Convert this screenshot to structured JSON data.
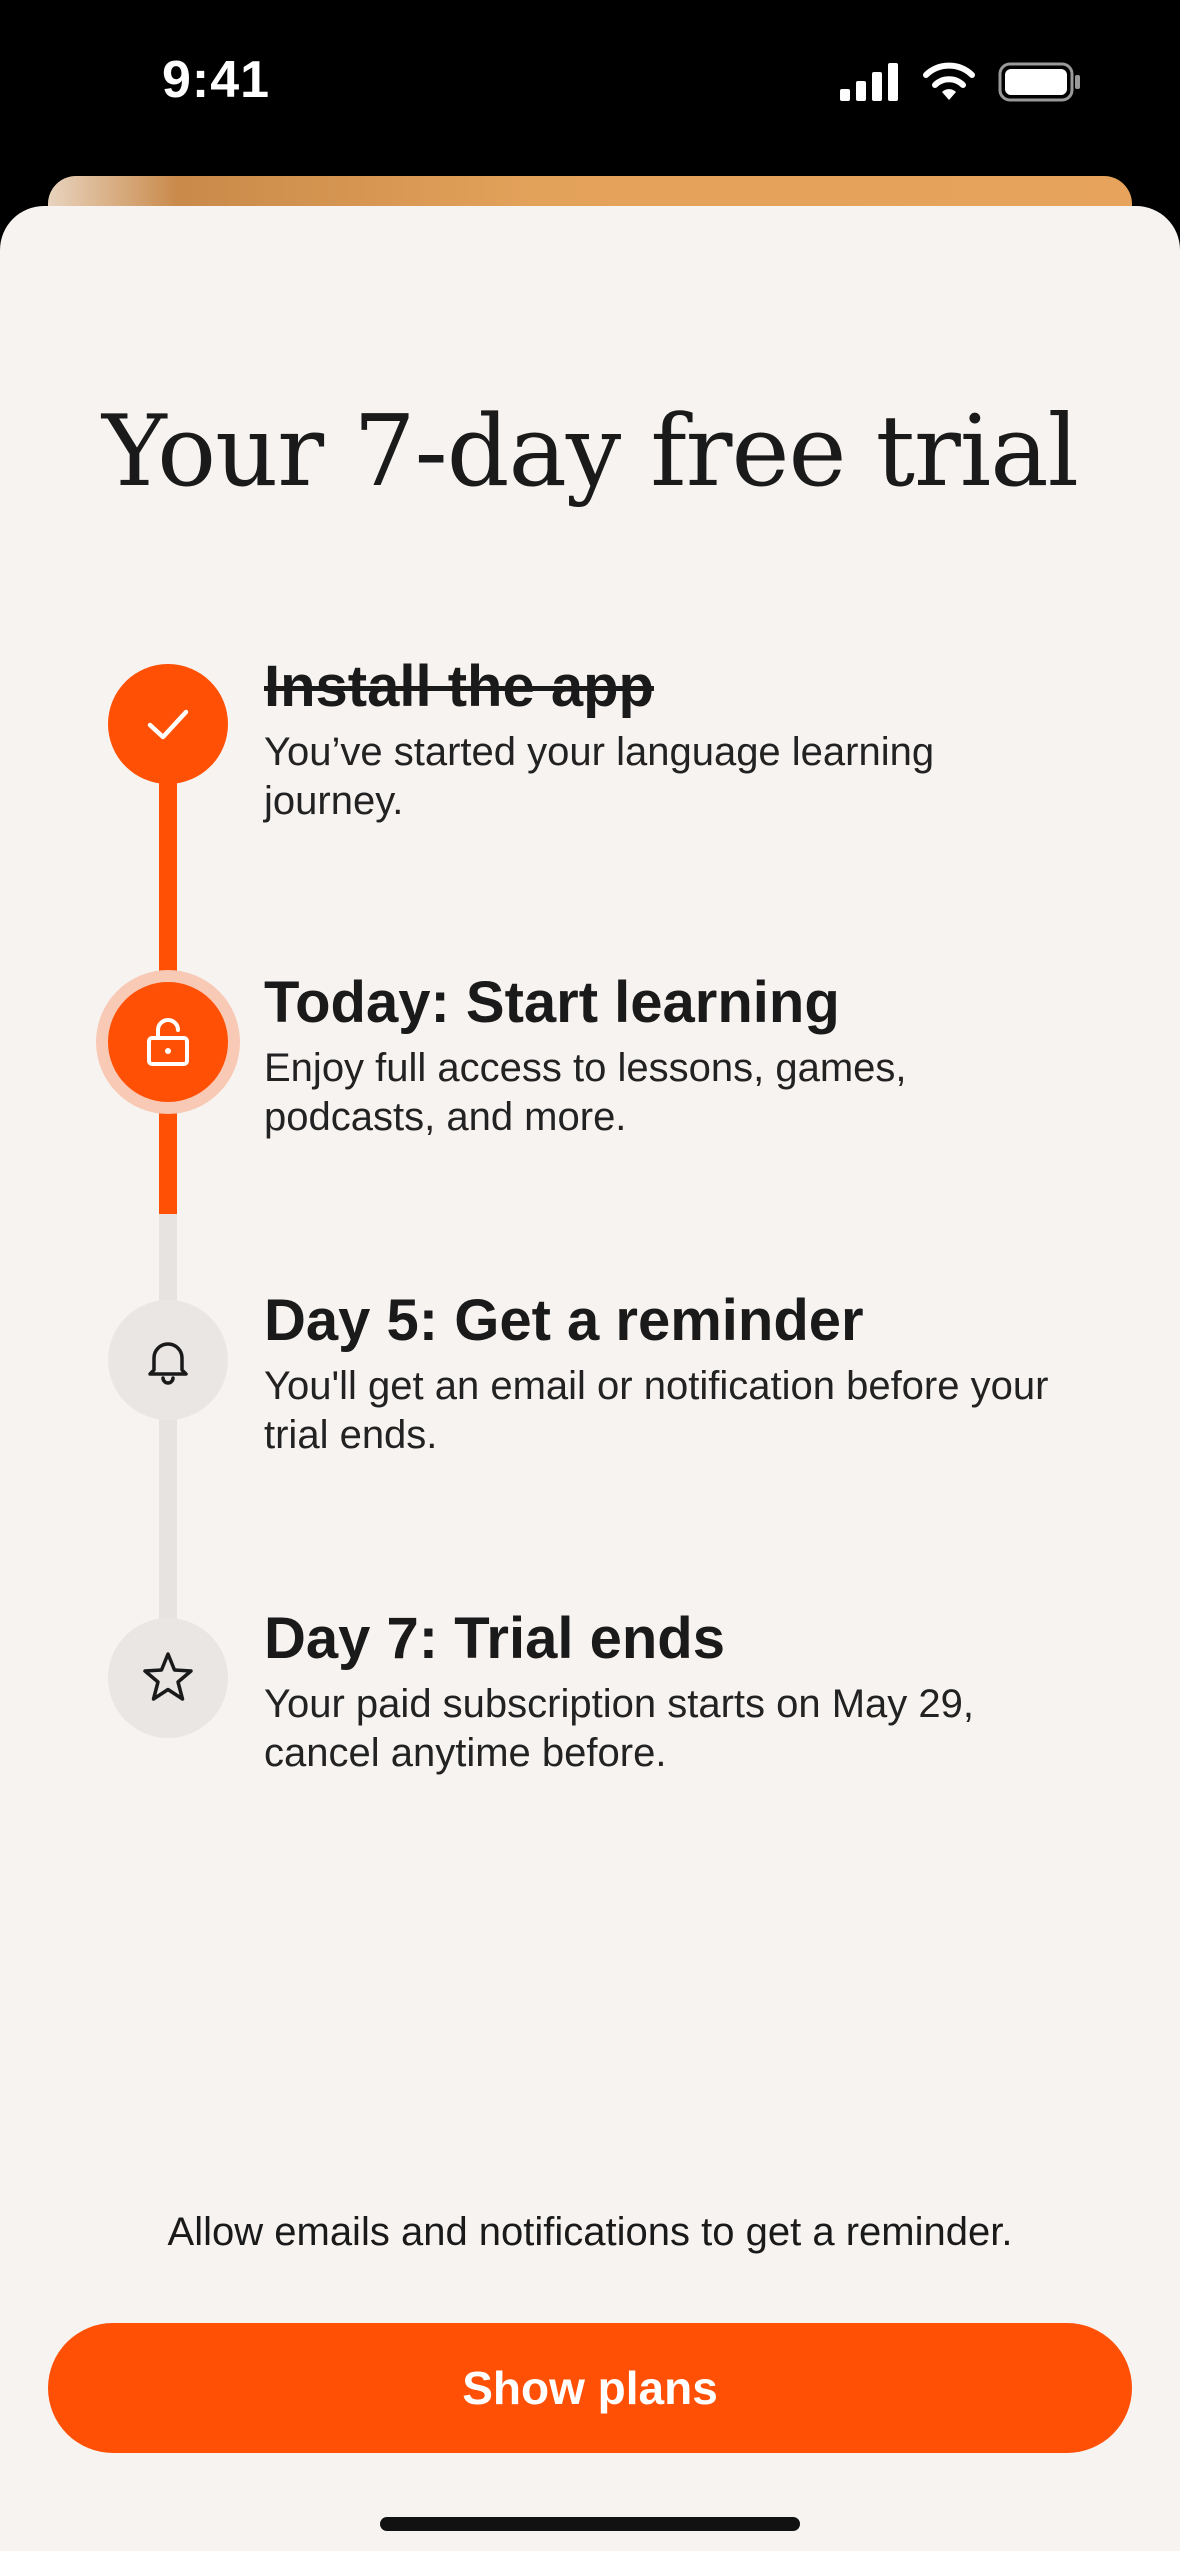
{
  "status_bar": {
    "time": "9:41",
    "icons": [
      "cellular-signal-icon",
      "wifi-icon",
      "battery-icon"
    ]
  },
  "title": "Your 7-day free trial",
  "colors": {
    "accent": "#ff5005",
    "accent_halo": "#f8c9b4",
    "sheet_background": "#f7f3f1",
    "inactive_track": "#e6e3e1",
    "text": "#1a1a1a"
  },
  "steps": [
    {
      "title": "Install the app",
      "description": "You’ve started your language learning journey.",
      "state": "completed",
      "icon": "checkmark-icon"
    },
    {
      "title": "Today: Start learning",
      "description": "Enjoy full access to lessons, games, podcasts, and more.",
      "state": "current",
      "icon": "unlock-icon"
    },
    {
      "title": "Day 5: Get a reminder",
      "description": "You'll get an email or notification before your trial ends.",
      "state": "upcoming",
      "icon": "bell-icon"
    },
    {
      "title": "Day 7: Trial ends",
      "description": "Your paid subscription starts on May 29, cancel anytime before.",
      "state": "upcoming",
      "icon": "star-icon"
    }
  ],
  "footer": {
    "note": "Allow emails and notifications to get a reminder.",
    "button_label": "Show plans"
  }
}
